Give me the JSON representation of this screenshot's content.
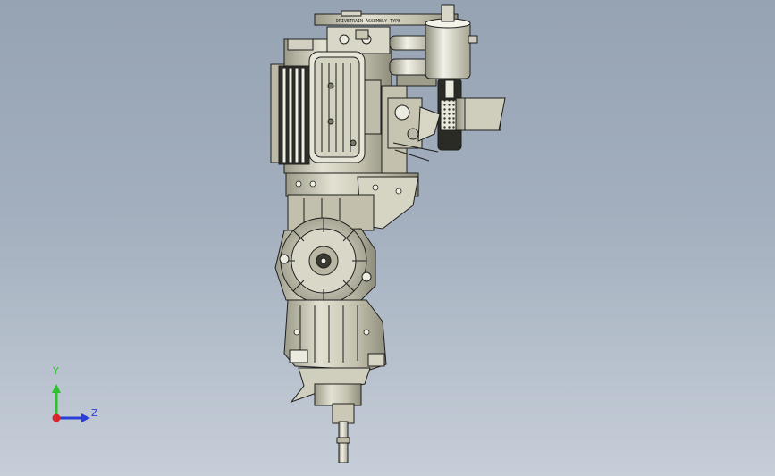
{
  "viewport": {
    "background_top": "#96a3b3",
    "background_bottom": "#c6ced8"
  },
  "model": {
    "part_label": "DRIVETRAIN ASSEMBLY-TYPE",
    "outline_color": "#1e1e1e",
    "body_color": "#c9c7b3",
    "shade_color": "#8d8b7a",
    "highlight_color": "#f4f3ea"
  },
  "triad": {
    "y_label": "Y",
    "z_label": "Z",
    "y_color": "#2ec02e",
    "z_color": "#2b3fd6",
    "x_color": "#d8242c"
  }
}
